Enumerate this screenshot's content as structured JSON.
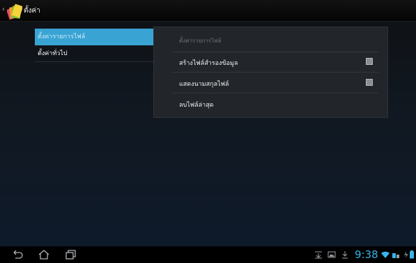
{
  "action_bar": {
    "title": "ตั้งค่า",
    "up_caret": "‹",
    "icon": "settings-app-icon"
  },
  "headers": {
    "items": [
      {
        "label": "ตั้งค่ารายการไฟล์",
        "selected": true
      },
      {
        "label": "ตั้งค่าทั่วไป",
        "selected": false
      }
    ]
  },
  "detail": {
    "heading": "ตั้งค่ารายการไฟล์",
    "prefs": [
      {
        "label": "สร้างไฟล์สำรองข้อมูล",
        "has_checkbox": true,
        "checked": false
      },
      {
        "label": "แสดงนามสกุลไฟล์",
        "has_checkbox": true,
        "checked": false
      },
      {
        "label": "ลบไฟล์ล่าสุด",
        "has_checkbox": false
      }
    ]
  },
  "system_bar": {
    "clock": "9:38",
    "accent_color": "#39b4e8",
    "nav_icons": [
      "back-icon",
      "home-icon",
      "recent-apps-icon"
    ],
    "status_icons": [
      "download-manager-icon",
      "gallery-icon",
      "download-icon",
      "wifi-icon",
      "battery-dock-icon",
      "battery-icon"
    ]
  },
  "colors": {
    "selected_header": "#39a4d4",
    "panel": "#22252a"
  }
}
